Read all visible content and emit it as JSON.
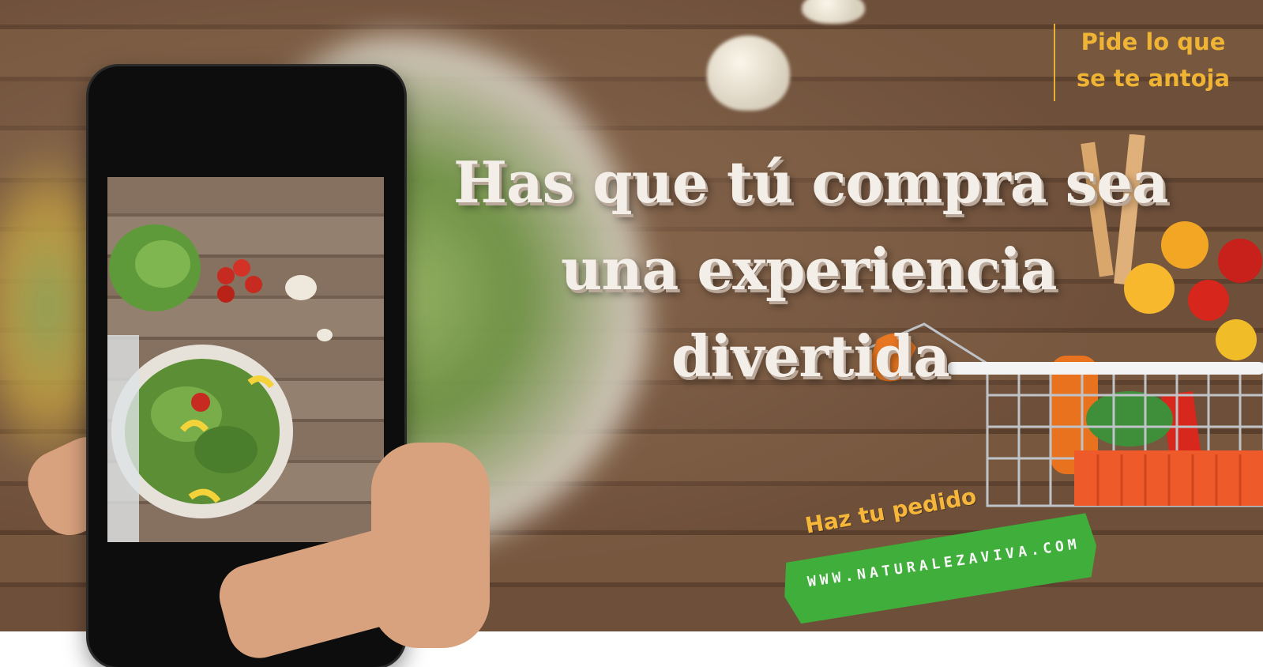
{
  "headline": {
    "line1": "Has que tú compra sea",
    "line2": "una experiencia",
    "line3": "divertida"
  },
  "tagline": {
    "line1": "Pide lo que",
    "line2": "se te antoja"
  },
  "cta": {
    "label": "Haz tu pedido",
    "url": "WWW.NATURALEZAVIVA.COM"
  },
  "colors": {
    "accent_orange": "#f0b435",
    "band_green": "#3fae3b",
    "headline": "#f3eee8"
  }
}
